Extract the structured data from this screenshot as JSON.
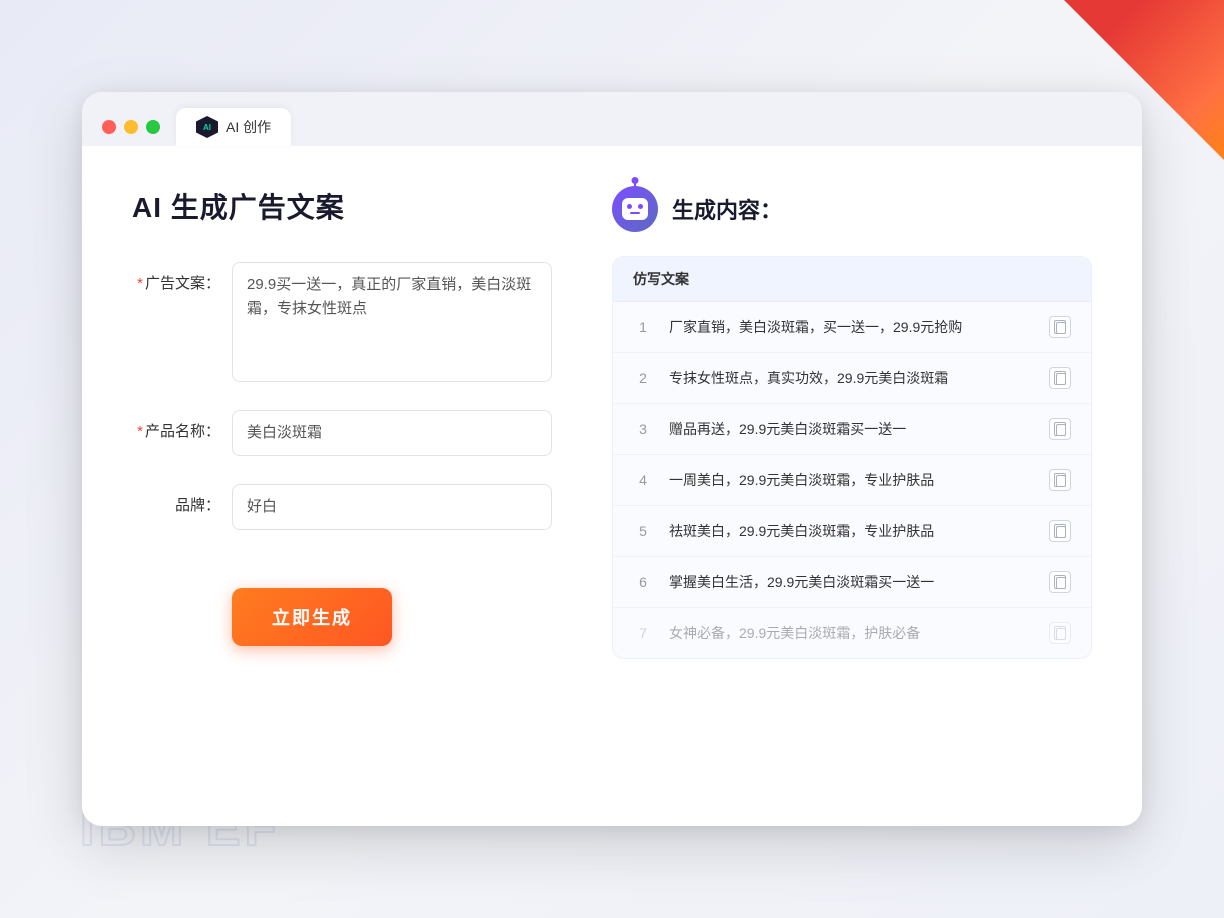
{
  "window": {
    "tab_label": "AI 创作"
  },
  "left_panel": {
    "title": "AI 生成广告文案",
    "form": {
      "ad_copy_label": "广告文案：",
      "ad_copy_required": "*",
      "ad_copy_value": "29.9买一送一，真正的厂家直销，美白淡斑霜，专抹女性斑点",
      "product_name_label": "产品名称：",
      "product_name_required": "*",
      "product_name_value": "美白淡斑霜",
      "brand_label": "品牌：",
      "brand_value": "好白"
    },
    "generate_button": "立即生成"
  },
  "right_panel": {
    "title": "生成内容：",
    "column_header": "仿写文案",
    "results": [
      {
        "num": "1",
        "text": "厂家直销，美白淡斑霜，买一送一，29.9元抢购"
      },
      {
        "num": "2",
        "text": "专抹女性斑点，真实功效，29.9元美白淡斑霜"
      },
      {
        "num": "3",
        "text": "赠品再送，29.9元美白淡斑霜买一送一"
      },
      {
        "num": "4",
        "text": "一周美白，29.9元美白淡斑霜，专业护肤品"
      },
      {
        "num": "5",
        "text": "祛斑美白，29.9元美白淡斑霜，专业护肤品"
      },
      {
        "num": "6",
        "text": "掌握美白生活，29.9元美白淡斑霜买一送一"
      },
      {
        "num": "7",
        "text": "女神必备，29.9元美白淡斑霜，护肤必备",
        "faded": true
      }
    ]
  },
  "bg_text": "IBM EF",
  "colors": {
    "accent_orange": "#ff5722",
    "accent_purple": "#7c4dff",
    "tab_bg": "#ffffff",
    "content_bg": "#ffffff",
    "window_bg": "#f0f2f8"
  }
}
